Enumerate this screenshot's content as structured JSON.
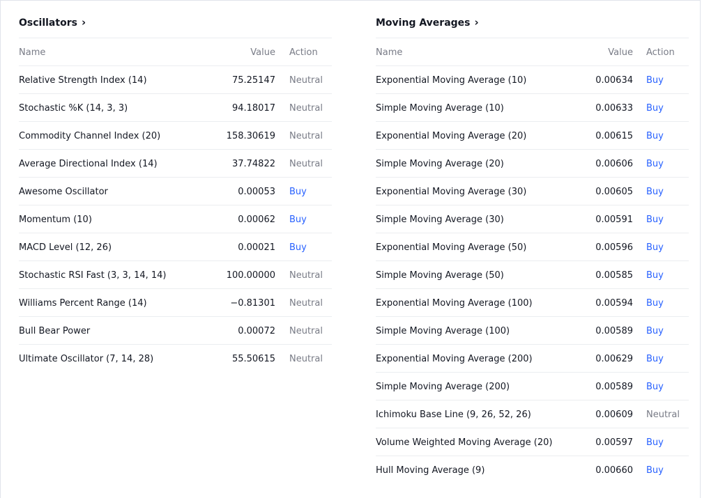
{
  "colors": {
    "text": "#131722",
    "muted": "#787b86",
    "buy": "#2962ff",
    "divider": "#ebedf0"
  },
  "oscillators": {
    "title": "Oscillators",
    "chevron": "›",
    "columns": {
      "name": "Name",
      "value": "Value",
      "action": "Action"
    },
    "rows": [
      {
        "name": "Relative Strength Index (14)",
        "value": "75.25147",
        "action": "Neutral"
      },
      {
        "name": "Stochastic %K (14, 3, 3)",
        "value": "94.18017",
        "action": "Neutral"
      },
      {
        "name": "Commodity Channel Index (20)",
        "value": "158.30619",
        "action": "Neutral"
      },
      {
        "name": "Average Directional Index (14)",
        "value": "37.74822",
        "action": "Neutral"
      },
      {
        "name": "Awesome Oscillator",
        "value": "0.00053",
        "action": "Buy"
      },
      {
        "name": "Momentum (10)",
        "value": "0.00062",
        "action": "Buy"
      },
      {
        "name": "MACD Level (12, 26)",
        "value": "0.00021",
        "action": "Buy"
      },
      {
        "name": "Stochastic RSI Fast (3, 3, 14, 14)",
        "value": "100.00000",
        "action": "Neutral"
      },
      {
        "name": "Williams Percent Range (14)",
        "value": "−0.81301",
        "action": "Neutral"
      },
      {
        "name": "Bull Bear Power",
        "value": "0.00072",
        "action": "Neutral"
      },
      {
        "name": "Ultimate Oscillator (7, 14, 28)",
        "value": "55.50615",
        "action": "Neutral"
      }
    ]
  },
  "moving_averages": {
    "title": "Moving Averages",
    "chevron": "›",
    "columns": {
      "name": "Name",
      "value": "Value",
      "action": "Action"
    },
    "rows": [
      {
        "name": "Exponential Moving Average (10)",
        "value": "0.00634",
        "action": "Buy"
      },
      {
        "name": "Simple Moving Average (10)",
        "value": "0.00633",
        "action": "Buy"
      },
      {
        "name": "Exponential Moving Average (20)",
        "value": "0.00615",
        "action": "Buy"
      },
      {
        "name": "Simple Moving Average (20)",
        "value": "0.00606",
        "action": "Buy"
      },
      {
        "name": "Exponential Moving Average (30)",
        "value": "0.00605",
        "action": "Buy"
      },
      {
        "name": "Simple Moving Average (30)",
        "value": "0.00591",
        "action": "Buy"
      },
      {
        "name": "Exponential Moving Average (50)",
        "value": "0.00596",
        "action": "Buy"
      },
      {
        "name": "Simple Moving Average (50)",
        "value": "0.00585",
        "action": "Buy"
      },
      {
        "name": "Exponential Moving Average (100)",
        "value": "0.00594",
        "action": "Buy"
      },
      {
        "name": "Simple Moving Average (100)",
        "value": "0.00589",
        "action": "Buy"
      },
      {
        "name": "Exponential Moving Average (200)",
        "value": "0.00629",
        "action": "Buy"
      },
      {
        "name": "Simple Moving Average (200)",
        "value": "0.00589",
        "action": "Buy"
      },
      {
        "name": "Ichimoku Base Line (9, 26, 52, 26)",
        "value": "0.00609",
        "action": "Neutral"
      },
      {
        "name": "Volume Weighted Moving Average (20)",
        "value": "0.00597",
        "action": "Buy"
      },
      {
        "name": "Hull Moving Average (9)",
        "value": "0.00660",
        "action": "Buy"
      }
    ]
  }
}
